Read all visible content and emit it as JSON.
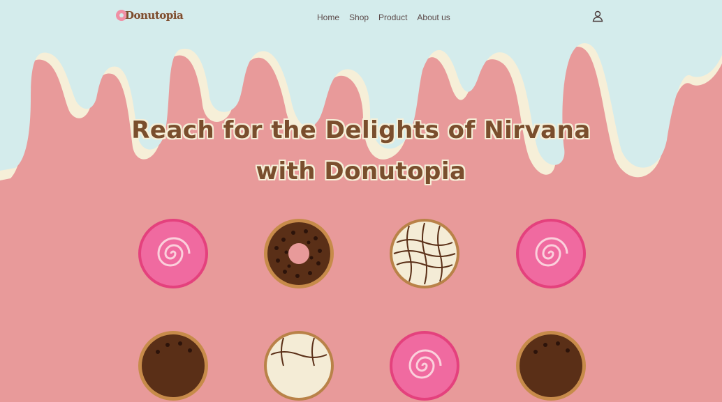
{
  "brand": {
    "name": "Donutopia"
  },
  "nav": {
    "items": [
      "Home",
      "Shop",
      "Product",
      "About us"
    ]
  },
  "hero": {
    "title_line1": "Reach for the Delights of Nirvana",
    "title_line2": "with Donutopia"
  },
  "colors": {
    "header_bg": "#d4ecec",
    "drip_cream": "#f6efd8",
    "pink_bg": "#e89a9a",
    "title_brown": "#7a4e2d"
  },
  "icons": {
    "account": "user-icon"
  },
  "donuts": {
    "row1": [
      "pink-swirl-donut",
      "chocolate-sprinkle-donut",
      "white-chocolate-drizzle-donut",
      "pink-swirl-donut"
    ],
    "row2": [
      "chocolate-sprinkle-donut",
      "white-chocolate-drizzle-donut",
      "pink-swirl-donut",
      "chocolate-sprinkle-donut"
    ]
  }
}
